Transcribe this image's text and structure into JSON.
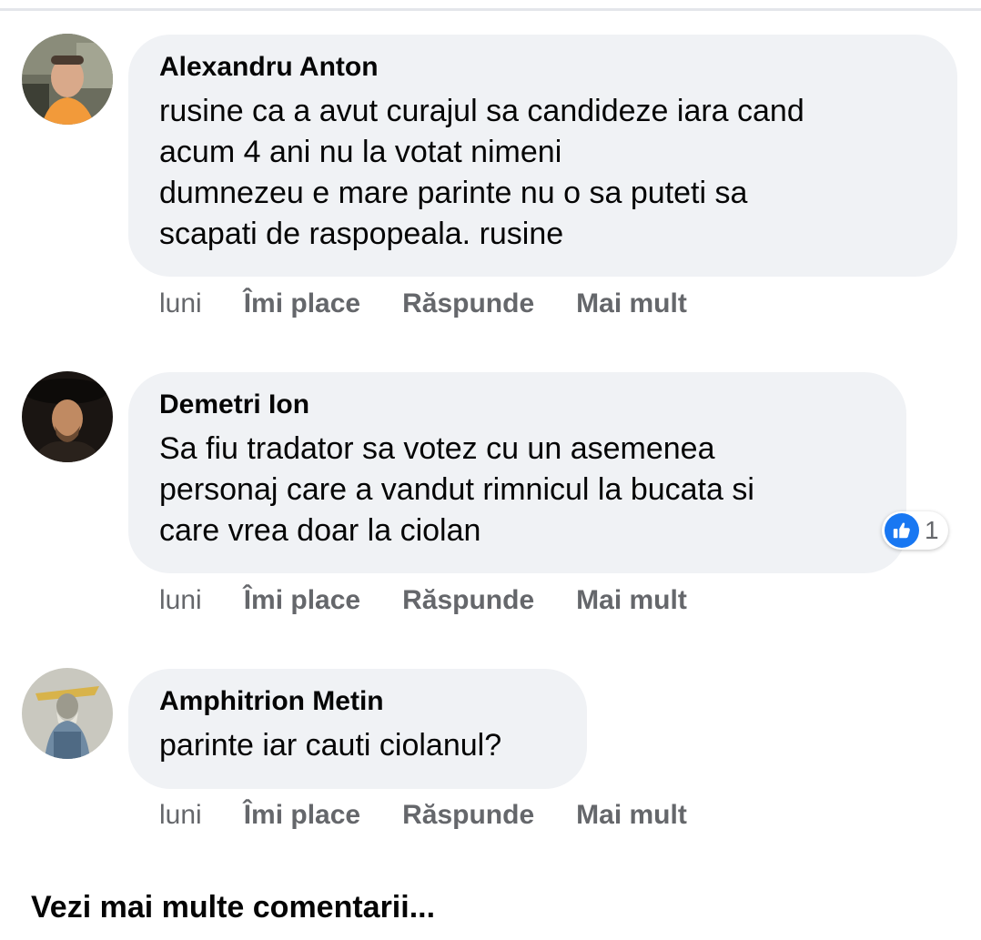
{
  "comments": [
    {
      "author": "Alexandru Anton",
      "lines": [
        "rusine ca a avut curajul sa candideze iara cand",
        "acum 4 ani nu la votat nimeni",
        "dumnezeu e mare parinte nu o sa puteti sa",
        "scapati de raspopeala. rusine"
      ],
      "time": "luni",
      "like_label": "Îmi place",
      "reply_label": "Răspunde",
      "more_label": "Mai mult"
    },
    {
      "author": "Demetri Ion",
      "lines": [
        "Sa fiu tradator sa votez cu un asemenea",
        "personaj care a vandut rimnicul la bucata si",
        "care vrea doar la ciolan"
      ],
      "reaction_count": "1",
      "reaction_icon": "thumbs-up-icon",
      "time": "luni",
      "like_label": "Îmi place",
      "reply_label": "Răspunde",
      "more_label": "Mai mult"
    },
    {
      "author": "Amphitrion Metin",
      "lines": [
        "parinte iar cauti ciolanul?"
      ],
      "time": "luni",
      "like_label": "Îmi place",
      "reply_label": "Răspunde",
      "more_label": "Mai mult"
    }
  ],
  "more_comments_label": "Vezi mai multe comentarii...",
  "colors": {
    "bubble": "#f0f2f5",
    "secondary_text": "#65676b",
    "like_blue": "#1877f2"
  }
}
